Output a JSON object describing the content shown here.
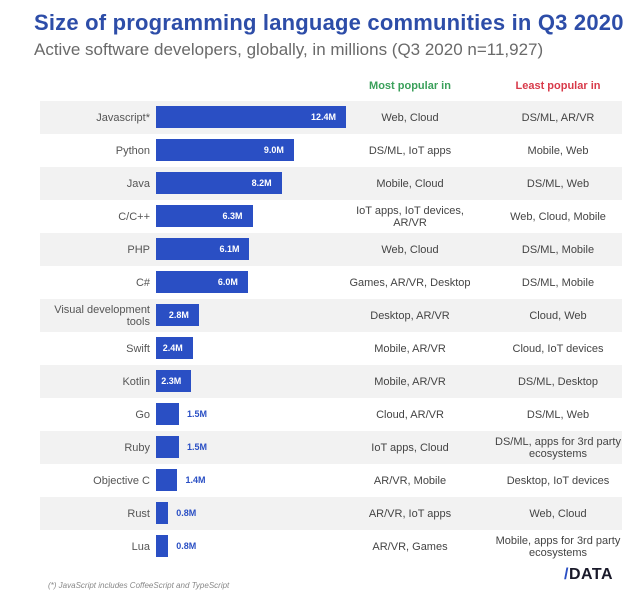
{
  "title": "Size of programming language communities in Q3 2020",
  "subtitle": "Active software developers, globally, in millions (Q3 2020 n=11,927)",
  "columns": {
    "most": "Most popular in",
    "least": "Least popular in"
  },
  "footnote": "(*) JavaScript includes CoffeeScript and TypeScript",
  "logo": {
    "slash": "/",
    "text": "DATA"
  },
  "colors": {
    "title": "#2d4da8",
    "bar": "#2a4fc4",
    "most_header": "#3aa05a",
    "least_header": "#d83a4a"
  },
  "chart_data": {
    "type": "bar",
    "orientation": "horizontal",
    "title": "Size of programming language communities in Q3 2020",
    "subtitle": "Active software developers, globally, in millions (Q3 2020 n=11,927)",
    "xlabel": "",
    "ylabel": "",
    "unit": "M",
    "xlim": [
      0,
      12.4
    ],
    "grid": false,
    "categories": [
      "Javascript*",
      "Python",
      "Java",
      "C/C++",
      "PHP",
      "C#",
      "Visual development tools",
      "Swift",
      "Kotlin",
      "Go",
      "Ruby",
      "Objective C",
      "Rust",
      "Lua"
    ],
    "values": [
      12.4,
      9.0,
      8.2,
      6.3,
      6.1,
      6.0,
      2.8,
      2.4,
      2.3,
      1.5,
      1.5,
      1.4,
      0.8,
      0.8
    ],
    "labels": [
      "12.4M",
      "9.0M",
      "8.2M",
      "6.3M",
      "6.1M",
      "6.0M",
      "2.8M",
      "2.4M",
      "2.3M",
      "1.5M",
      "1.5M",
      "1.4M",
      "0.8M",
      "0.8M"
    ],
    "most_popular_in": [
      "Web, Cloud",
      "DS/ML, IoT apps",
      "Mobile, Cloud",
      "IoT apps, IoT devices, AR/VR",
      "Web, Cloud",
      "Games, AR/VR, Desktop",
      "Desktop, AR/VR",
      "Mobile, AR/VR",
      "Mobile, AR/VR",
      "Cloud, AR/VR",
      "IoT apps, Cloud",
      "AR/VR, Mobile",
      "AR/VR, IoT apps",
      "AR/VR, Games"
    ],
    "least_popular_in": [
      "DS/ML, AR/VR",
      "Mobile, Web",
      "DS/ML, Web",
      "Web, Cloud, Mobile",
      "DS/ML, Mobile",
      "DS/ML, Mobile",
      "Cloud, Web",
      "Cloud, IoT devices",
      "DS/ML, Desktop",
      "DS/ML, Web",
      "DS/ML, apps for 3rd party ecosystems",
      "Desktop, IoT devices",
      "Web, Cloud",
      "Mobile, apps for 3rd party ecosystems"
    ]
  }
}
